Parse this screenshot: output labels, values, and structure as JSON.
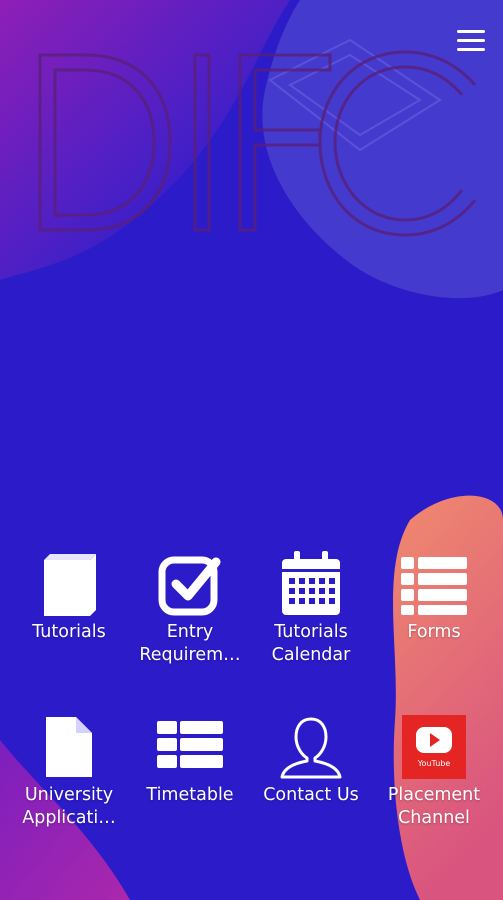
{
  "logo": {
    "text": "DIFC"
  },
  "menu": {
    "icon": "hamburger-icon"
  },
  "colors": {
    "background": "#2c1bc9",
    "accent_purple": "#9a1fb4",
    "accent_coral": "#e97a72",
    "youtube_red": "#e52424"
  },
  "tiles": [
    {
      "label": "Tutorials",
      "label2": "",
      "icon": "book-icon"
    },
    {
      "label": "Entry",
      "label2": "Requirem…",
      "icon": "checkbox-icon"
    },
    {
      "label": "Tutorials",
      "label2": "Calendar",
      "icon": "calendar-icon"
    },
    {
      "label": "Forms",
      "label2": "",
      "icon": "list-icon"
    },
    {
      "label": "University",
      "label2": "Applicati…",
      "icon": "document-icon"
    },
    {
      "label": "Timetable",
      "label2": "",
      "icon": "table-icon"
    },
    {
      "label": "Contact Us",
      "label2": "",
      "icon": "person-icon"
    },
    {
      "label": "Placement",
      "label2": "Channel",
      "icon": "youtube-icon",
      "icon_text": "YouTube"
    }
  ]
}
